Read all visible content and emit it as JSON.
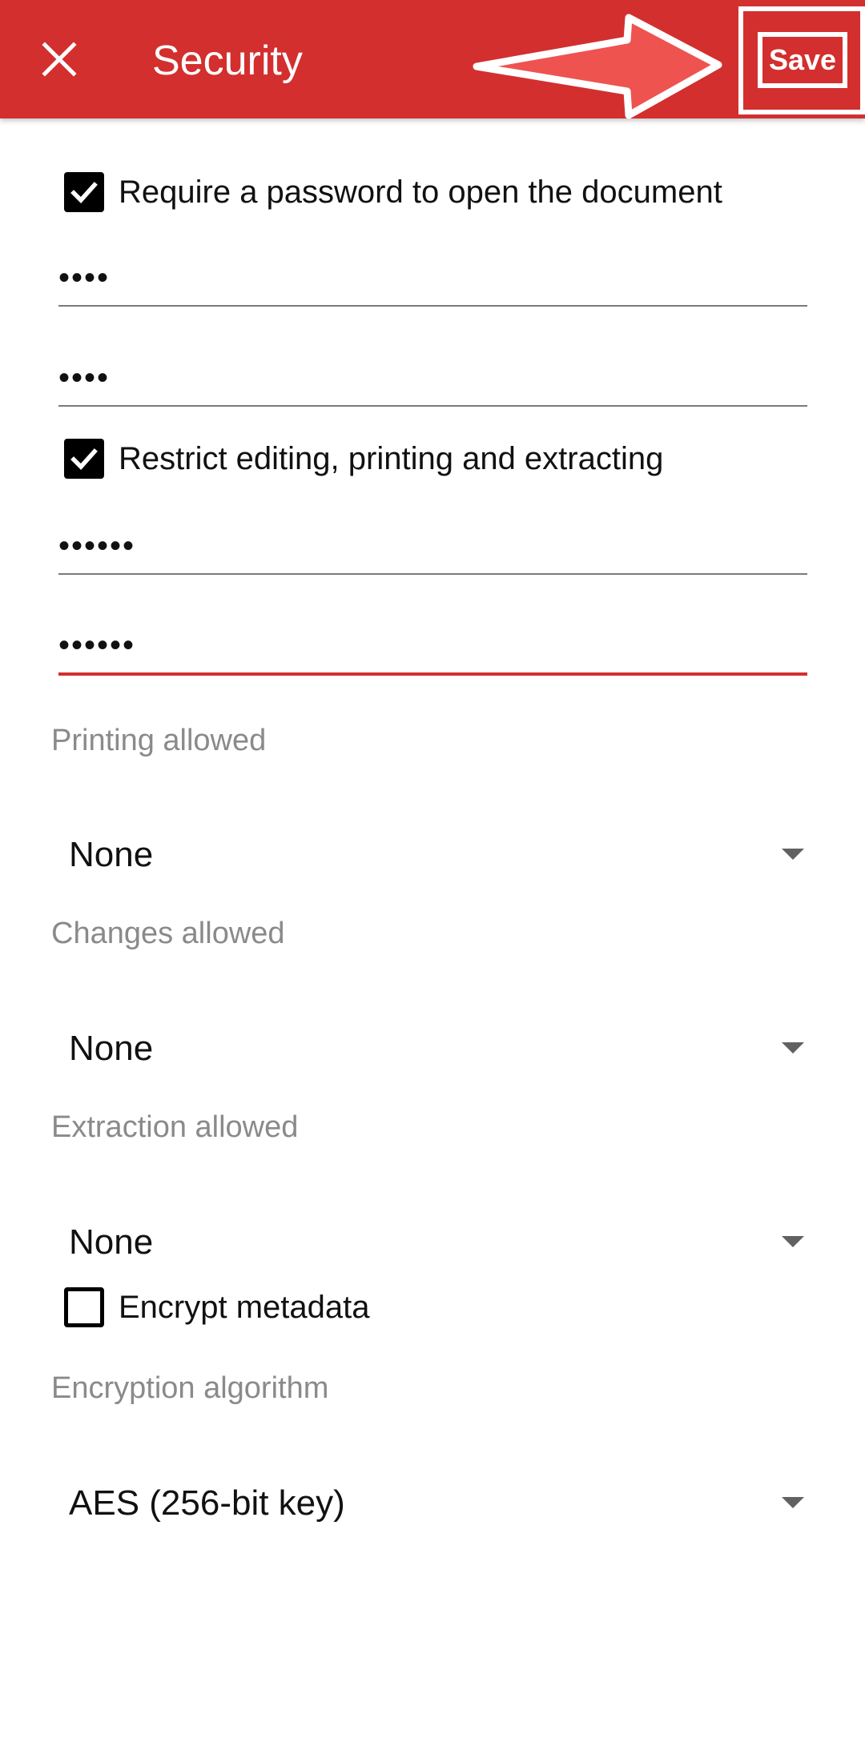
{
  "appbar": {
    "title": "Security",
    "save_label": "Save",
    "close_icon": "close-icon",
    "bg_color": "#d32f2f"
  },
  "open_password": {
    "checkbox_label": "Require a password to open the document",
    "checked": true,
    "password_value": "••••",
    "confirm_value": "••••"
  },
  "restrict": {
    "checkbox_label": "Restrict editing, printing and extracting",
    "checked": true,
    "password_value": "••••••",
    "confirm_value": "••••••"
  },
  "printing": {
    "label": "Printing allowed",
    "value": "None"
  },
  "changes": {
    "label": "Changes allowed",
    "value": "None"
  },
  "extraction": {
    "label": "Extraction allowed",
    "value": "None"
  },
  "encrypt_metadata": {
    "label": "Encrypt metadata",
    "checked": false
  },
  "algorithm": {
    "label": "Encryption algorithm",
    "value": "AES (256-bit key)"
  },
  "accent_color": "#d32f2f"
}
